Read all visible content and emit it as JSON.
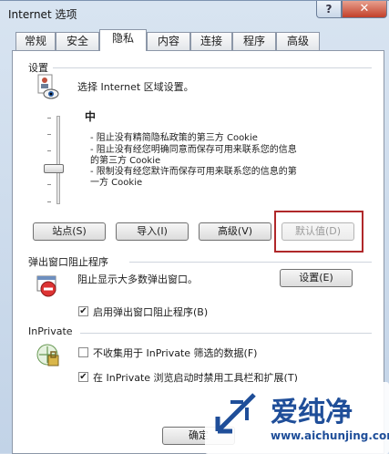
{
  "window": {
    "title": "Internet 选项",
    "help": "?",
    "close": "✕"
  },
  "tabs": [
    "常规",
    "安全",
    "隐私",
    "内容",
    "连接",
    "程序",
    "高级"
  ],
  "settings": {
    "group_title": "设置",
    "zone_text": "选择 Internet 区域设置。",
    "level": "中",
    "desc": [
      "- 阻止没有精简隐私政策的第三方 Cookie",
      "- 阻止没有经您明确同意而保存可用来联系您的信息",
      "的第三方 Cookie",
      "- 限制没有经您默许而保存可用来联系您的信息的第",
      "一方 Cookie"
    ],
    "buttons": {
      "sites": "站点(S)",
      "import": "导入(I)",
      "advanced": "高级(V)",
      "default": "默认值(D)"
    }
  },
  "popup": {
    "group_title": "弹出窗口阻止程序",
    "text": "阻止显示大多数弹出窗口。",
    "settings_button": "设置(E)",
    "enable_label": "启用弹出窗口阻止程序(B)",
    "enable_checked": "✔"
  },
  "inprivate": {
    "group_title": "InPrivate",
    "option1": "不收集用于 InPrivate 筛选的数据(F)",
    "option2": "在 InPrivate 浏览启动时禁用工具栏和扩展(T)",
    "option2_checked": "✔"
  },
  "footer": {
    "ok": "确定"
  },
  "watermark": {
    "brand": "爱纯净",
    "url": "www.aichunjing.com"
  }
}
